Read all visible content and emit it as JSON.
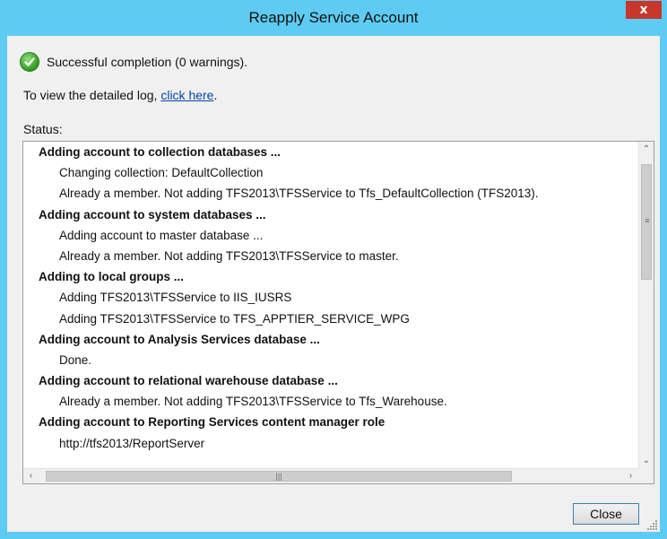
{
  "window": {
    "title": "Reapply Service Account",
    "close_glyph": "x"
  },
  "result": {
    "icon": "success-check-icon",
    "message": "Successful completion (0 warnings)."
  },
  "log": {
    "prefix": "To view the detailed log, ",
    "link_text": "click here",
    "suffix": "."
  },
  "status": {
    "label": "Status:",
    "lines": [
      {
        "type": "header",
        "text": "Adding account to collection databases ..."
      },
      {
        "type": "detail",
        "text": "Changing collection: DefaultCollection"
      },
      {
        "type": "detail",
        "text": "Already a member. Not adding TFS2013\\TFSService to Tfs_DefaultCollection (TFS2013)."
      },
      {
        "type": "header",
        "text": "Adding account to system databases ..."
      },
      {
        "type": "detail",
        "text": "Adding account to master database ..."
      },
      {
        "type": "detail",
        "text": "Already a member. Not adding TFS2013\\TFSService to master."
      },
      {
        "type": "header",
        "text": "Adding to local groups ..."
      },
      {
        "type": "detail",
        "text": "Adding TFS2013\\TFSService to IIS_IUSRS"
      },
      {
        "type": "detail",
        "text": "Adding TFS2013\\TFSService to TFS_APPTIER_SERVICE_WPG"
      },
      {
        "type": "header",
        "text": "Adding account to Analysis Services database ..."
      },
      {
        "type": "detail",
        "text": "Done."
      },
      {
        "type": "header",
        "text": "Adding account to relational warehouse database ..."
      },
      {
        "type": "detail",
        "text": "Already a member. Not adding TFS2013\\TFSService to Tfs_Warehouse."
      },
      {
        "type": "header",
        "text": "Adding account to Reporting Services content manager role"
      },
      {
        "type": "detail",
        "text": "http://tfs2013/ReportServer"
      }
    ]
  },
  "buttons": {
    "close_label": "Close"
  },
  "colors": {
    "titlebar": "#5ecbf2",
    "close_x": "#c7372b",
    "link": "#0645ad",
    "success": "#2e9a1f"
  }
}
